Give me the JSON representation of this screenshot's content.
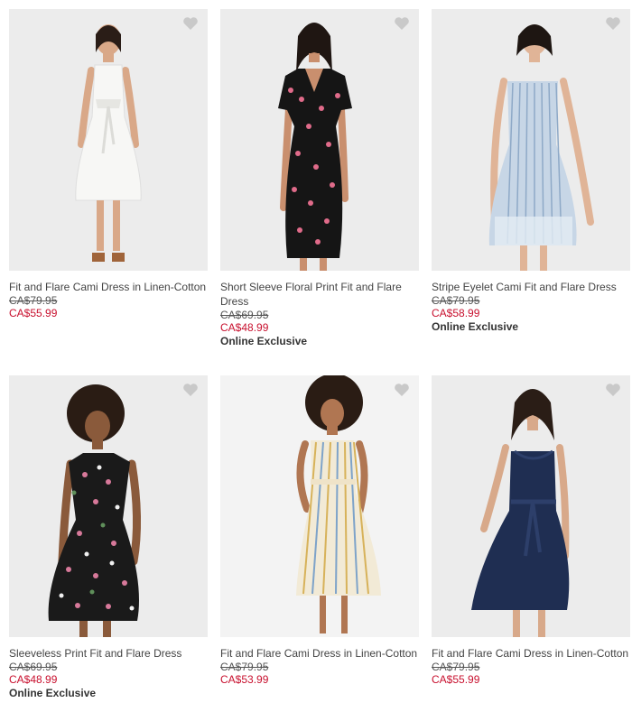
{
  "colors": {
    "sale_price": "#c8102e",
    "photo_bg": "#ececec",
    "heart_icon": "#c9c9c9"
  },
  "products": [
    {
      "name": "Fit and Flare Cami Dress in Linen-Cotton",
      "original_price": "CA$79.95",
      "sale_price": "CA$55.99",
      "badge": "",
      "favorite_icon": "heart-icon"
    },
    {
      "name": "Short Sleeve Floral Print Fit and Flare Dress",
      "original_price": "CA$69.95",
      "sale_price": "CA$48.99",
      "badge": "Online Exclusive",
      "favorite_icon": "heart-icon"
    },
    {
      "name": "Stripe Eyelet Cami Fit and Flare Dress",
      "original_price": "CA$79.95",
      "sale_price": "CA$58.99",
      "badge": "Online Exclusive",
      "favorite_icon": "heart-icon"
    },
    {
      "name": "Sleeveless Print Fit and Flare Dress",
      "original_price": "CA$69.95",
      "sale_price": "CA$48.99",
      "badge": "Online Exclusive",
      "favorite_icon": "heart-icon"
    },
    {
      "name": "Fit and Flare Cami Dress in Linen-Cotton",
      "original_price": "CA$79.95",
      "sale_price": "CA$53.99",
      "badge": "",
      "favorite_icon": "heart-icon"
    },
    {
      "name": "Fit and Flare Cami Dress in Linen-Cotton",
      "original_price": "CA$79.95",
      "sale_price": "CA$55.99",
      "badge": "",
      "favorite_icon": "heart-icon"
    }
  ]
}
